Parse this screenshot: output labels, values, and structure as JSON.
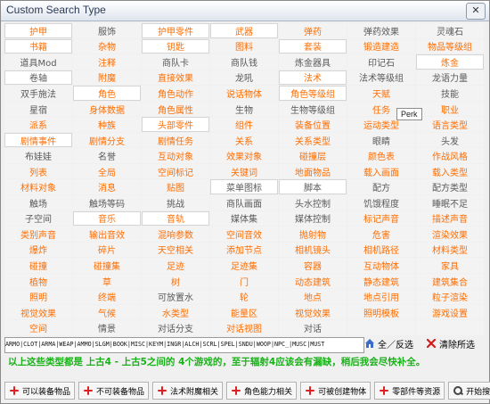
{
  "window": {
    "title": "Custom Search Type",
    "close": "✕"
  },
  "grid": [
    [
      "护甲",
      "服饰",
      "护甲零件",
      "武器",
      "弹药",
      "弹药效果",
      "灵魂石"
    ],
    [
      "书籍",
      "杂物",
      "钥匙",
      "图料",
      "套装",
      "锻造建造",
      "物品等级组"
    ],
    [
      "道具Mod",
      "注释",
      "商队卡",
      "商队钱",
      "炼金器具",
      "印记石",
      "炼金"
    ],
    [
      "卷轴",
      "附魔",
      "直接效果",
      "龙吼",
      "法术",
      "法术等级组",
      "龙语力量"
    ],
    [
      "双手施法",
      "角色",
      "角色动作",
      "说话物体",
      "角色等级组",
      "天赋",
      "技能"
    ],
    [
      "星宿",
      "身体数据",
      "角色属性",
      "生物",
      "生物等级组",
      "任务",
      "职业"
    ],
    [
      "派系",
      "种族",
      "头部零件",
      "组件",
      "装备位置",
      "运动类型",
      "语言类型"
    ],
    [
      "剧情事件",
      "剧情分支",
      "剧情任务",
      "关系",
      "关系类型",
      "眼睛",
      "头发"
    ],
    [
      "布娃娃",
      "名誉",
      "互动对象",
      "效果对象",
      "碰撞层",
      "颜色表",
      "作战风格"
    ],
    [
      "列表",
      "全局",
      "空间标记",
      "关键词",
      "地面物品",
      "载入画面",
      "载入类型"
    ],
    [
      "材料对象",
      "消息",
      "贴图",
      "菜单图标",
      "脚本",
      "配方",
      "配方类型"
    ],
    [
      "触场",
      "触场等码",
      "挑战",
      "商队画面",
      "头水控制",
      "饥饿程度",
      "睡眠不足"
    ],
    [
      "子空间",
      "音乐",
      "音轨",
      "媒体集",
      "媒体控制",
      "标记声音",
      "描述声音"
    ],
    [
      "类别声音",
      "输出音效",
      "混响参数",
      "空间音效",
      "抛射物",
      "危害",
      "渲染效果"
    ],
    [
      "爆炸",
      "碎片",
      "天空相关",
      "添加节点",
      "相机镜头",
      "相机路径",
      "材料类型"
    ],
    [
      "碰撞",
      "碰撞集",
      "足迹",
      "足迹集",
      "容器",
      "互动物体",
      "家具"
    ],
    [
      "植物",
      "草",
      "树",
      "门",
      "动态建筑",
      "静态建筑",
      "建筑集合"
    ],
    [
      "照明",
      "终端",
      "可放置水",
      "轮",
      "地点",
      "地点引用",
      "粒子渲染"
    ],
    [
      "视觉效果",
      "气候",
      "水类型",
      "能量区",
      "视觉效果",
      "照明模板",
      "游戏设置"
    ],
    [
      "空间",
      "情景",
      "对话分支",
      "对话视图",
      "对话",
      "",
      ""
    ]
  ],
  "cellStyle": [
    [
      "orange",
      "gray",
      "orange",
      "orange",
      "orange",
      "gray",
      "gray"
    ],
    [
      "orange",
      "orange",
      "orange",
      "orange",
      "orange",
      "orange",
      "orange"
    ],
    [
      "gray",
      "orange",
      "gray",
      "gray",
      "gray",
      "gray",
      "orange"
    ],
    [
      "gray",
      "orange",
      "orange",
      "gray",
      "orange",
      "gray",
      "gray"
    ],
    [
      "gray",
      "orange",
      "orange",
      "orange",
      "orange",
      "orange",
      "gray"
    ],
    [
      "gray",
      "orange",
      "orange",
      "gray",
      "gray",
      "orange",
      "orange"
    ],
    [
      "orange",
      "orange",
      "orange",
      "orange",
      "orange",
      "orange",
      "orange"
    ],
    [
      "orange",
      "orange",
      "orange",
      "orange",
      "orange",
      "gray",
      "gray"
    ],
    [
      "gray",
      "gray",
      "orange",
      "orange",
      "orange",
      "orange",
      "orange"
    ],
    [
      "orange",
      "orange",
      "orange",
      "orange",
      "orange",
      "orange",
      "orange"
    ],
    [
      "orange",
      "orange",
      "orange",
      "gray",
      "gray",
      "gray",
      "gray"
    ],
    [
      "gray",
      "gray",
      "gray",
      "gray",
      "gray",
      "gray",
      "gray"
    ],
    [
      "gray",
      "orange",
      "orange",
      "gray",
      "gray",
      "orange",
      "orange"
    ],
    [
      "orange",
      "orange",
      "orange",
      "orange",
      "orange",
      "orange",
      "orange"
    ],
    [
      "orange",
      "orange",
      "orange",
      "orange",
      "orange",
      "orange",
      "orange"
    ],
    [
      "orange",
      "orange",
      "orange",
      "orange",
      "orange",
      "orange",
      "orange"
    ],
    [
      "orange",
      "orange",
      "orange",
      "orange",
      "orange",
      "orange",
      "orange"
    ],
    [
      "orange",
      "orange",
      "gray",
      "orange",
      "orange",
      "orange",
      "orange"
    ],
    [
      "orange",
      "orange",
      "orange",
      "orange",
      "orange",
      "orange",
      "orange"
    ],
    [
      "orange",
      "gray",
      "gray",
      "orange",
      "gray",
      "gray",
      "gray"
    ]
  ],
  "selected": [
    [
      0,
      0
    ],
    [
      0,
      2
    ],
    [
      0,
      3
    ],
    [
      1,
      0
    ],
    [
      1,
      2
    ],
    [
      1,
      4
    ],
    [
      2,
      6
    ],
    [
      3,
      0
    ],
    [
      3,
      4
    ],
    [
      4,
      1
    ],
    [
      4,
      4
    ],
    [
      6,
      2
    ],
    [
      7,
      0
    ],
    [
      10,
      3
    ],
    [
      10,
      4
    ],
    [
      12,
      1
    ],
    [
      12,
      2
    ]
  ],
  "tooltip": "Perk",
  "tagbar": "ARMO|CLOT|ARMA|WEAP|AMMO|SLGM|BOOK|MISC|KEYM|INGR|ALCH|SCRL|SPEL|SNDU|WOOP|NPC_|MUSC|MUST",
  "controls": {
    "toggle_all": "全／反选",
    "clear": "清除所选"
  },
  "note": "以上这些类型都是 上古4 - 上古5之间的 4个游戏的，至于辐射4应该会有漏缺，稍后我会尽快补全。",
  "footer": [
    "可以装备物品",
    "不可装备物品",
    "法术附魔相关",
    "角色能力相关",
    "可被创建物体",
    "零部件等资源"
  ],
  "search_label": "开始搜索",
  "colors": {
    "accent_orange": "#ff6d00",
    "gray_text": "#5a5a5a",
    "green_note": "#18b218"
  }
}
